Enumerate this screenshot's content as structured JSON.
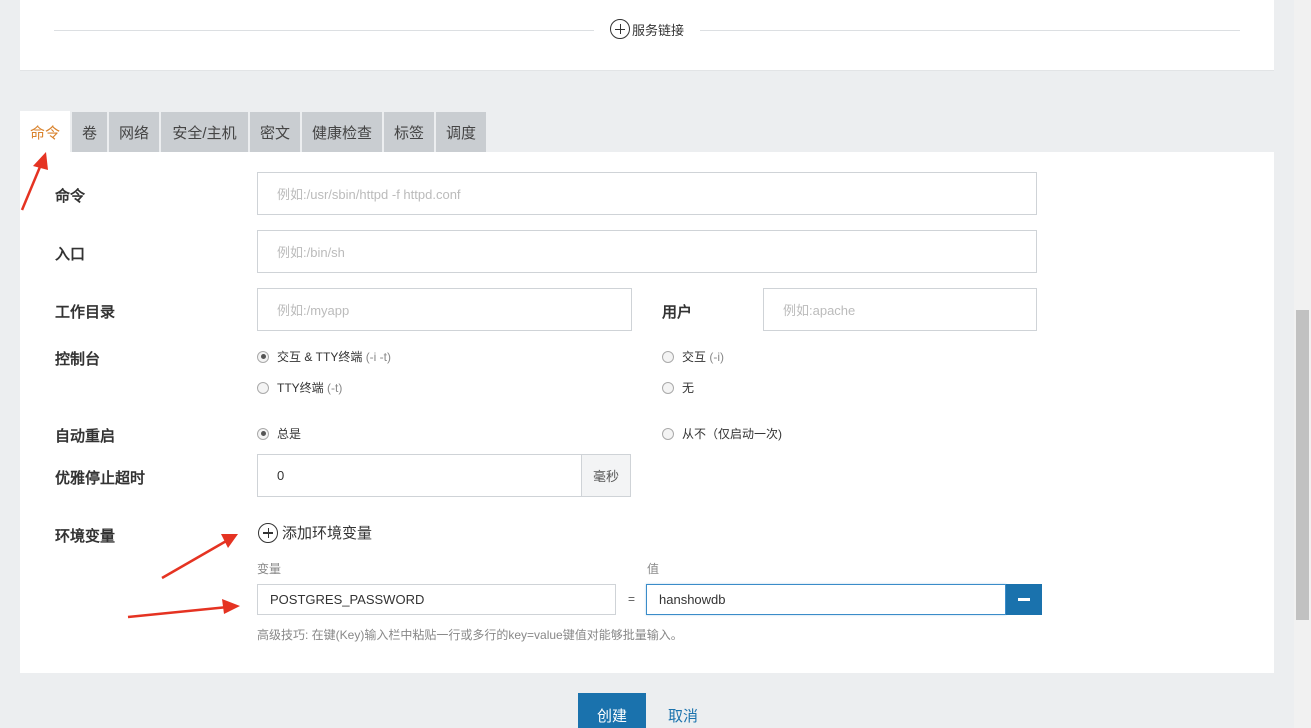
{
  "service_link": {
    "label": "服务链接"
  },
  "tabs": [
    {
      "label": "命令",
      "active": true
    },
    {
      "label": "卷"
    },
    {
      "label": "网络"
    },
    {
      "label": "安全/主机"
    },
    {
      "label": "密文"
    },
    {
      "label": "健康检查"
    },
    {
      "label": "标签"
    },
    {
      "label": "调度"
    }
  ],
  "form": {
    "command": {
      "label": "命令",
      "placeholder": "例如:/usr/sbin/httpd -f httpd.conf",
      "value": ""
    },
    "entrypoint": {
      "label": "入口",
      "placeholder": "例如:/bin/sh",
      "value": ""
    },
    "workdir": {
      "label": "工作目录",
      "placeholder": "例如:/myapp",
      "value": ""
    },
    "user": {
      "label": "用户",
      "placeholder": "例如:apache",
      "value": ""
    },
    "console": {
      "label": "控制台",
      "options": [
        {
          "label": "交互 & TTY终端",
          "hint": "(-i -t)",
          "checked": true
        },
        {
          "label": "交互",
          "hint": "(-i)",
          "checked": false
        },
        {
          "label": "TTY终端",
          "hint": "(-t)",
          "checked": false
        },
        {
          "label": "无",
          "hint": "",
          "checked": false
        }
      ]
    },
    "restart": {
      "label": "自动重启",
      "options": [
        {
          "label": "总是",
          "checked": true
        },
        {
          "label": "从不（仅启动一次)",
          "checked": false
        }
      ]
    },
    "graceful_stop": {
      "label": "优雅停止超时",
      "value": "0",
      "unit": "毫秒"
    },
    "env": {
      "label": "环境变量",
      "add_label": "添加环境变量",
      "var_header": "变量",
      "value_header": "值",
      "equals": "=",
      "rows": [
        {
          "key": "POSTGRES_PASSWORD",
          "value": "hanshowdb"
        }
      ],
      "tip": "高级技巧: 在键(Key)输入栏中粘贴一行或多行的key=value键值对能够批量输入。"
    }
  },
  "buttons": {
    "create": "创建",
    "cancel": "取消"
  },
  "colors": {
    "accent": "#1a72ad",
    "active_tab": "#d9822b",
    "annotation_arrow": "#e53322"
  }
}
